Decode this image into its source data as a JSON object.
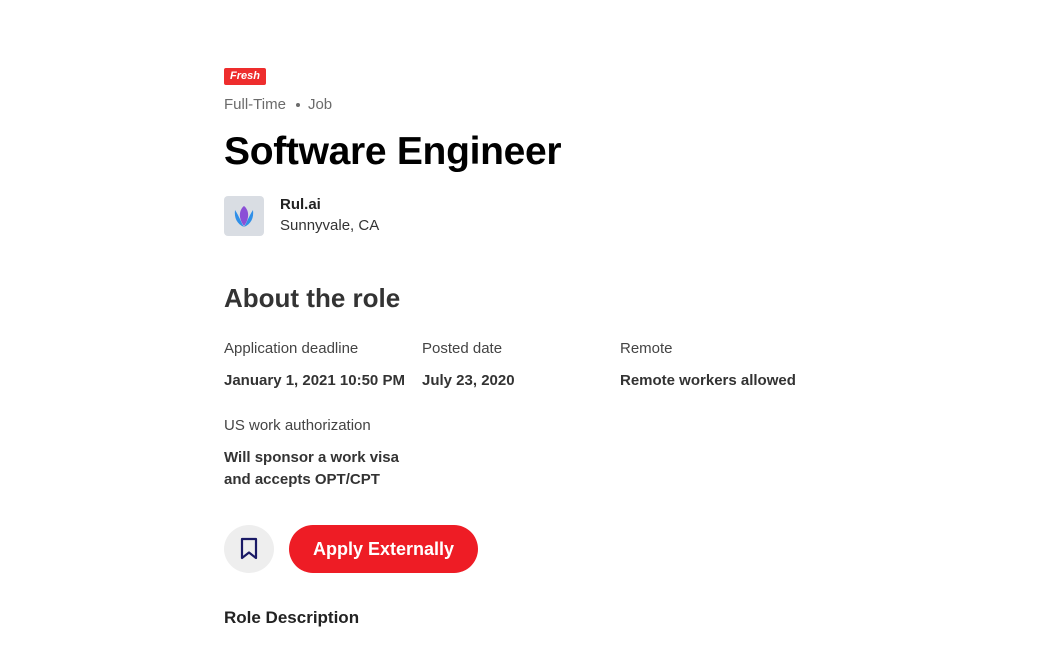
{
  "job": {
    "badge": "Fresh",
    "type": "Full-Time",
    "kind": "Job",
    "title": "Software Engineer"
  },
  "company": {
    "name": "Rul.ai",
    "location": "Sunnyvale, CA",
    "logo_icon": "tulip-logo-icon"
  },
  "about": {
    "heading": "About the role",
    "details": [
      {
        "label": "Application deadline",
        "value": "January 1, 2021 10:50 PM"
      },
      {
        "label": "Posted date",
        "value": "July 23, 2020"
      },
      {
        "label": "Remote",
        "value": "Remote workers allowed"
      },
      {
        "label": "US work authorization",
        "value": "Will sponsor a work visa and accepts OPT/CPT"
      }
    ]
  },
  "actions": {
    "bookmark_icon": "bookmark-icon",
    "apply_label": "Apply Externally"
  },
  "role_description": {
    "heading": "Role Description"
  },
  "colors": {
    "accent": "#ee1c25",
    "badge": "#ee2d2d",
    "bookmark_icon": "#1a1a66"
  }
}
